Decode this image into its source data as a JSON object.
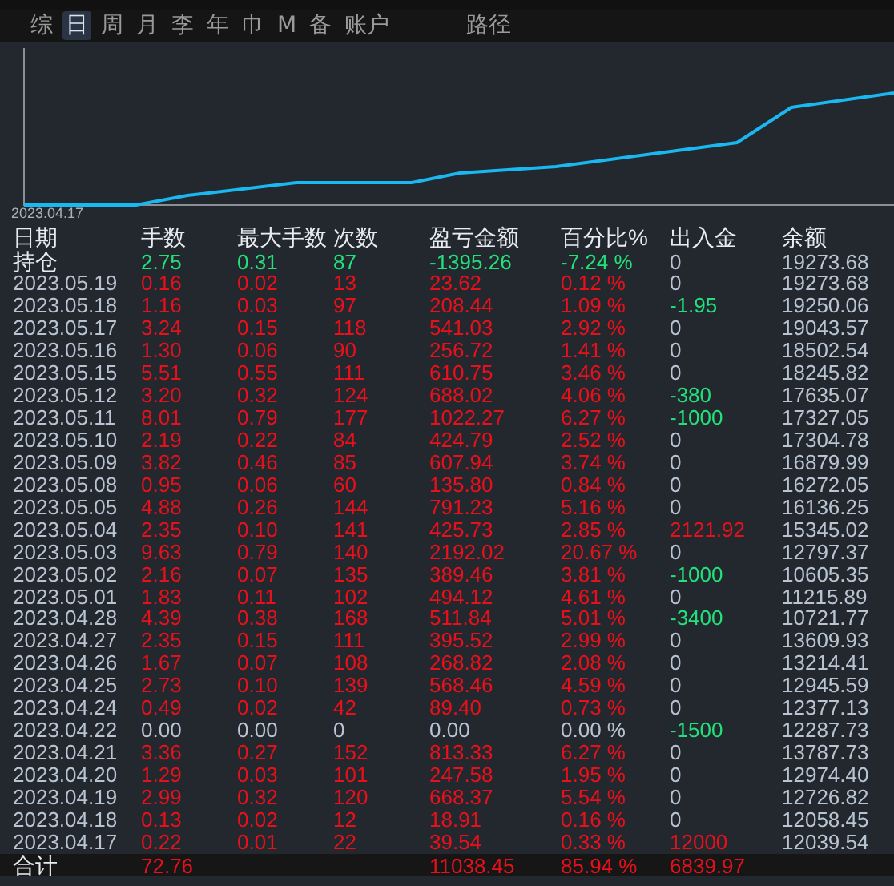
{
  "tabs": [
    {
      "label": "综",
      "selected": false
    },
    {
      "label": "日",
      "selected": true
    },
    {
      "label": "周",
      "selected": false
    },
    {
      "label": "月",
      "selected": false
    },
    {
      "label": "李",
      "selected": false
    },
    {
      "label": "年",
      "selected": false
    },
    {
      "label": "巾",
      "selected": false
    },
    {
      "label": "M",
      "selected": false
    },
    {
      "label": "备",
      "selected": false
    },
    {
      "label": "账户",
      "selected": false
    },
    {
      "label": "路径",
      "selected": false
    }
  ],
  "chart": {
    "start_label": "2023.04.17"
  },
  "table": {
    "columns": [
      "日期",
      "手数",
      "最大手数",
      "次数",
      "盈亏金额",
      "百分比%",
      "出入金",
      "余额"
    ],
    "rows": [
      {
        "kind": "holding",
        "date": "持仓",
        "color": "#22e07a",
        "values": [
          "2.75",
          "0.31",
          "87",
          "-1395.26",
          "-7.24 %"
        ],
        "flow": {
          "text": "0",
          "color": "#b8c4d2"
        },
        "balance": "19273.68"
      },
      {
        "kind": "day",
        "date": "2023.05.19",
        "color": "#e8101a",
        "values": [
          "0.16",
          "0.02",
          "13",
          "23.62",
          "0.12 %"
        ],
        "flow": {
          "text": "0",
          "color": "#b8c4d2"
        },
        "balance": "19273.68"
      },
      {
        "kind": "day",
        "date": "2023.05.18",
        "color": "#e8101a",
        "values": [
          "1.16",
          "0.03",
          "97",
          "208.44",
          "1.09 %"
        ],
        "flow": {
          "text": "-1.95",
          "color": "#22e07a"
        },
        "balance": "19250.06"
      },
      {
        "kind": "day",
        "date": "2023.05.17",
        "color": "#e8101a",
        "values": [
          "3.24",
          "0.15",
          "118",
          "541.03",
          "2.92 %"
        ],
        "flow": {
          "text": "0",
          "color": "#b8c4d2"
        },
        "balance": "19043.57"
      },
      {
        "kind": "day",
        "date": "2023.05.16",
        "color": "#e8101a",
        "values": [
          "1.30",
          "0.06",
          "90",
          "256.72",
          "1.41 %"
        ],
        "flow": {
          "text": "0",
          "color": "#b8c4d2"
        },
        "balance": "18502.54"
      },
      {
        "kind": "day",
        "date": "2023.05.15",
        "color": "#e8101a",
        "values": [
          "5.51",
          "0.55",
          "111",
          "610.75",
          "3.46 %"
        ],
        "flow": {
          "text": "0",
          "color": "#b8c4d2"
        },
        "balance": "18245.82"
      },
      {
        "kind": "day",
        "date": "2023.05.12",
        "color": "#e8101a",
        "values": [
          "3.20",
          "0.32",
          "124",
          "688.02",
          "4.06 %"
        ],
        "flow": {
          "text": "-380",
          "color": "#22e07a"
        },
        "balance": "17635.07"
      },
      {
        "kind": "day",
        "date": "2023.05.11",
        "color": "#e8101a",
        "values": [
          "8.01",
          "0.79",
          "177",
          "1022.27",
          "6.27 %"
        ],
        "flow": {
          "text": "-1000",
          "color": "#22e07a"
        },
        "balance": "17327.05"
      },
      {
        "kind": "day",
        "date": "2023.05.10",
        "color": "#e8101a",
        "values": [
          "2.19",
          "0.22",
          "84",
          "424.79",
          "2.52 %"
        ],
        "flow": {
          "text": "0",
          "color": "#b8c4d2"
        },
        "balance": "17304.78"
      },
      {
        "kind": "day",
        "date": "2023.05.09",
        "color": "#e8101a",
        "values": [
          "3.82",
          "0.46",
          "85",
          "607.94",
          "3.74 %"
        ],
        "flow": {
          "text": "0",
          "color": "#b8c4d2"
        },
        "balance": "16879.99"
      },
      {
        "kind": "day",
        "date": "2023.05.08",
        "color": "#e8101a",
        "values": [
          "0.95",
          "0.06",
          "60",
          "135.80",
          "0.84 %"
        ],
        "flow": {
          "text": "0",
          "color": "#b8c4d2"
        },
        "balance": "16272.05"
      },
      {
        "kind": "day",
        "date": "2023.05.05",
        "color": "#e8101a",
        "values": [
          "4.88",
          "0.26",
          "144",
          "791.23",
          "5.16 %"
        ],
        "flow": {
          "text": "0",
          "color": "#b8c4d2"
        },
        "balance": "16136.25"
      },
      {
        "kind": "day",
        "date": "2023.05.04",
        "color": "#e8101a",
        "values": [
          "2.35",
          "0.10",
          "141",
          "425.73",
          "2.85 %"
        ],
        "flow": {
          "text": "2121.92",
          "color": "#e8101a"
        },
        "balance": "15345.02"
      },
      {
        "kind": "day",
        "date": "2023.05.03",
        "color": "#e8101a",
        "values": [
          "9.63",
          "0.79",
          "140",
          "2192.02",
          "20.67 %"
        ],
        "flow": {
          "text": "0",
          "color": "#b8c4d2"
        },
        "balance": "12797.37"
      },
      {
        "kind": "day",
        "date": "2023.05.02",
        "color": "#e8101a",
        "values": [
          "2.16",
          "0.07",
          "135",
          "389.46",
          "3.81 %"
        ],
        "flow": {
          "text": "-1000",
          "color": "#22e07a"
        },
        "balance": "10605.35"
      },
      {
        "kind": "day",
        "date": "2023.05.01",
        "color": "#e8101a",
        "values": [
          "1.83",
          "0.11",
          "102",
          "494.12",
          "4.61 %"
        ],
        "flow": {
          "text": "0",
          "color": "#b8c4d2"
        },
        "balance": "11215.89"
      },
      {
        "kind": "day",
        "date": "2023.04.28",
        "color": "#e8101a",
        "values": [
          "4.39",
          "0.38",
          "168",
          "511.84",
          "5.01 %"
        ],
        "flow": {
          "text": "-3400",
          "color": "#22e07a"
        },
        "balance": "10721.77"
      },
      {
        "kind": "day",
        "date": "2023.04.27",
        "color": "#e8101a",
        "values": [
          "2.35",
          "0.15",
          "111",
          "395.52",
          "2.99 %"
        ],
        "flow": {
          "text": "0",
          "color": "#b8c4d2"
        },
        "balance": "13609.93"
      },
      {
        "kind": "day",
        "date": "2023.04.26",
        "color": "#e8101a",
        "values": [
          "1.67",
          "0.07",
          "108",
          "268.82",
          "2.08 %"
        ],
        "flow": {
          "text": "0",
          "color": "#b8c4d2"
        },
        "balance": "13214.41"
      },
      {
        "kind": "day",
        "date": "2023.04.25",
        "color": "#e8101a",
        "values": [
          "2.73",
          "0.10",
          "139",
          "568.46",
          "4.59 %"
        ],
        "flow": {
          "text": "0",
          "color": "#b8c4d2"
        },
        "balance": "12945.59"
      },
      {
        "kind": "day",
        "date": "2023.04.24",
        "color": "#e8101a",
        "values": [
          "0.49",
          "0.02",
          "42",
          "89.40",
          "0.73 %"
        ],
        "flow": {
          "text": "0",
          "color": "#b8c4d2"
        },
        "balance": "12377.13"
      },
      {
        "kind": "day",
        "date": "2023.04.22",
        "color": "#b8c4d2",
        "values": [
          "0.00",
          "0.00",
          "0",
          "0.00",
          "0.00 %"
        ],
        "flow": {
          "text": "-1500",
          "color": "#22e07a"
        },
        "balance": "12287.73"
      },
      {
        "kind": "day",
        "date": "2023.04.21",
        "color": "#e8101a",
        "values": [
          "3.36",
          "0.27",
          "152",
          "813.33",
          "6.27 %"
        ],
        "flow": {
          "text": "0",
          "color": "#b8c4d2"
        },
        "balance": "13787.73"
      },
      {
        "kind": "day",
        "date": "2023.04.20",
        "color": "#e8101a",
        "values": [
          "1.29",
          "0.03",
          "101",
          "247.58",
          "1.95 %"
        ],
        "flow": {
          "text": "0",
          "color": "#b8c4d2"
        },
        "balance": "12974.40"
      },
      {
        "kind": "day",
        "date": "2023.04.19",
        "color": "#e8101a",
        "values": [
          "2.99",
          "0.32",
          "120",
          "668.37",
          "5.54 %"
        ],
        "flow": {
          "text": "0",
          "color": "#b8c4d2"
        },
        "balance": "12726.82"
      },
      {
        "kind": "day",
        "date": "2023.04.18",
        "color": "#e8101a",
        "values": [
          "0.13",
          "0.02",
          "12",
          "18.91",
          "0.16 %"
        ],
        "flow": {
          "text": "0",
          "color": "#b8c4d2"
        },
        "balance": "12058.45"
      },
      {
        "kind": "day",
        "date": "2023.04.17",
        "color": "#e8101a",
        "values": [
          "0.22",
          "0.01",
          "22",
          "39.54",
          "0.33 %"
        ],
        "flow": {
          "text": "12000",
          "color": "#e8101a"
        },
        "balance": "12039.54"
      }
    ],
    "total": {
      "label": "合计",
      "lots": "72.76",
      "profit": "11038.45",
      "percent": "85.94 %",
      "flow": "6839.97"
    }
  }
}
